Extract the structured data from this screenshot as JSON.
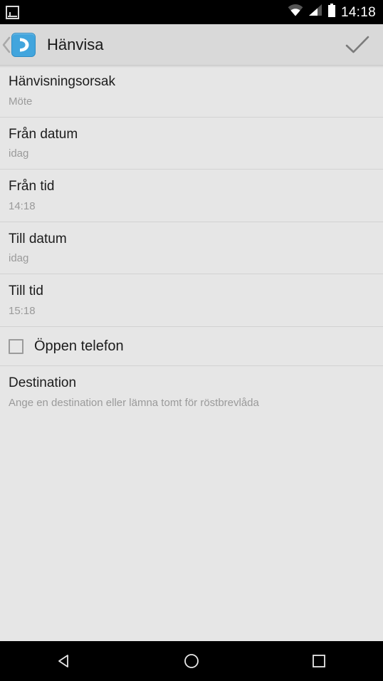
{
  "status_bar": {
    "notification_icon": "image-notification-icon",
    "wifi_icon": "wifi-icon",
    "signal_icon": "cellular-signal-icon",
    "battery_icon": "battery-icon",
    "time": "14:18"
  },
  "action_bar": {
    "up_icon": "up-chevron-icon",
    "app_icon": "phone-handset-icon",
    "title": "Hänvisa",
    "confirm_icon": "checkmark-icon",
    "accent_color": "#42a5dd",
    "background_color": "#d9d9d9"
  },
  "list": {
    "rows": [
      {
        "title": "Hänvisningsorsak",
        "value": "Möte"
      },
      {
        "title": "Från datum",
        "value": "idag"
      },
      {
        "title": "Från tid",
        "value": "14:18"
      },
      {
        "title": "Till datum",
        "value": "idag"
      },
      {
        "title": "Till tid",
        "value": "15:18"
      }
    ],
    "checkbox_row": {
      "label": "Öppen telefon",
      "checked": false
    },
    "destination_row": {
      "title": "Destination",
      "value": "Ange en destination eller lämna tomt för röstbrevlåda"
    }
  },
  "nav_bar": {
    "back_icon": "back-triangle-icon",
    "home_icon": "home-circle-icon",
    "recents_icon": "recents-square-icon"
  }
}
